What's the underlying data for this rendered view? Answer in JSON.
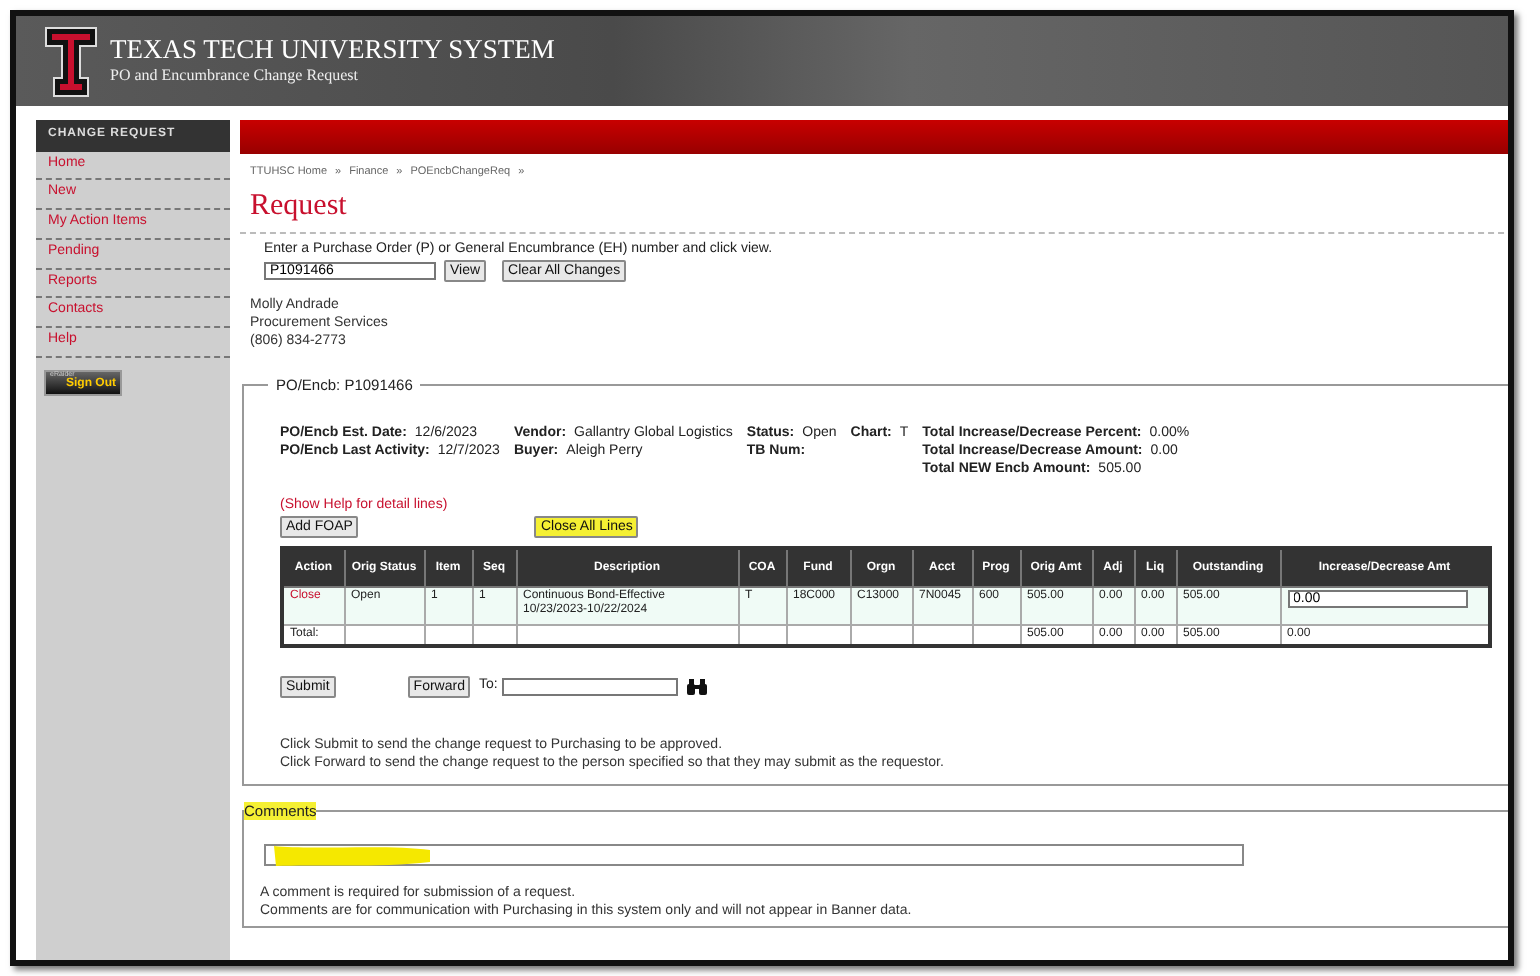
{
  "header": {
    "title": "TEXAS TECH UNIVERSITY SYSTEM",
    "subtitle": "PO and Encumbrance Change Request"
  },
  "sidebar": {
    "heading": "CHANGE REQUEST",
    "items": [
      {
        "label": "Home"
      },
      {
        "label": "New"
      },
      {
        "label": "My Action Items"
      },
      {
        "label": "Pending"
      },
      {
        "label": "Reports"
      },
      {
        "label": "Contacts"
      },
      {
        "label": "Help"
      }
    ],
    "signout": {
      "caption": "eRaider",
      "label": "Sign Out"
    }
  },
  "breadcrumb": {
    "separator": "»",
    "items": [
      "TTUHSC Home",
      "Finance",
      "POEncbChangeReq"
    ]
  },
  "page_title": "Request",
  "lookup": {
    "prompt": "Enter a Purchase Order (P) or General Encumbrance (EH) number and click view.",
    "value": "P1091466",
    "buttons": [
      "View",
      "Clear All Changes"
    ]
  },
  "contact": [
    "Molly Andrade",
    "Procurement Services",
    "(806) 834-2773"
  ],
  "po_panel": {
    "legend_label": "PO/Encb:",
    "legend_value": "P1091466",
    "detail_columns": [
      {
        "fields": [
          {
            "label": "PO/Encb Est. Date:",
            "value": "12/6/2023"
          },
          {
            "label": "PO/Encb Last Activity:",
            "value": "12/7/2023"
          }
        ]
      },
      {
        "fields": [
          {
            "label": "Vendor:",
            "value": "Gallantry Global Logistics"
          },
          {
            "label": "Buyer:",
            "value": "Aleigh Perry"
          }
        ]
      },
      {
        "fields": [
          {
            "label": "Status:",
            "value": "Open"
          },
          {
            "label": "TB Num:"
          }
        ]
      },
      {
        "fields": [
          {
            "label": "Chart:",
            "value": "T"
          }
        ]
      },
      {
        "fields": [
          {
            "label": "Total Increase/Decrease Percent:",
            "value": "0.00%"
          },
          {
            "label": "Total Increase/Decrease Amount:",
            "value": "0.00"
          },
          {
            "label": "Total NEW Encb Amount:",
            "value": "505.00"
          }
        ]
      }
    ],
    "help_link": "(Show Help for detail lines)",
    "buttons": [
      {
        "label": "Add FOAP",
        "highlighted": false
      },
      {
        "label": "Close All Lines",
        "highlighted": true
      }
    ],
    "table": {
      "columns": [
        "Action",
        "Orig Status",
        "Item",
        "Seq",
        "Description",
        "COA",
        "Fund",
        "Orgn",
        "Acct",
        "Prog",
        "Orig Amt",
        "Adj",
        "Liq",
        "Outstanding",
        "Increase/Decrease Amt"
      ],
      "rows": [
        {
          "kind": "line",
          "cells": [
            "Close",
            "Open",
            "1",
            "1",
            "Continuous Bond-Effective 10/23/2023-10/22/2024",
            "T",
            "18C000",
            "C13000",
            "7N0045",
            "600",
            "505.00",
            "0.00",
            "0.00",
            "505.00",
            "0.00"
          ]
        },
        {
          "kind": "total",
          "cells": [
            "Total:",
            "",
            "",
            "",
            "",
            "",
            "",
            "",
            "",
            "",
            "505.00",
            "0.00",
            "0.00",
            "505.00",
            "0.00"
          ]
        }
      ]
    },
    "submit": "Submit",
    "forward": "Forward",
    "forward_to_label": "To:",
    "notes": [
      "Click Submit to send the change request to Purchasing to be approved.",
      "Click Forward to send the change request to the person specified so that they may submit as the requestor."
    ]
  },
  "comments": {
    "legend": "Comments",
    "legend_highlighted": true,
    "field_highlighted": true,
    "notes": [
      "A comment is required for submission of a request.",
      "Comments are for communication with Purchasing in this system only and will not appear in Banner data."
    ]
  }
}
